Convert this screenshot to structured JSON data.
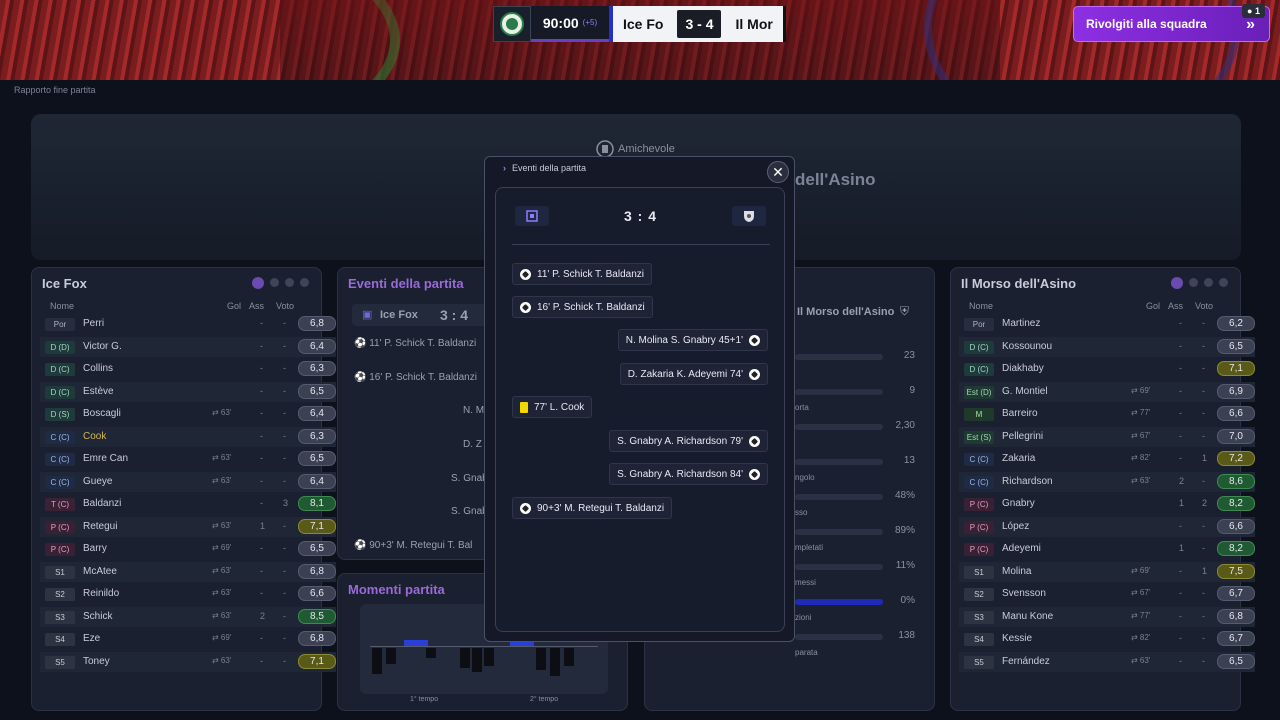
{
  "breadcrumb": "Rapporto fine partita",
  "scoreboard": {
    "time": "90:00",
    "added": "(+5)",
    "home": "Ice Fo",
    "score": "3 - 4",
    "away": "Il Mor"
  },
  "team_button": {
    "label": "Rivolgiti alla squadra",
    "notif": "1"
  },
  "hero": {
    "competition": "Amichevole",
    "away_name_partial": "dell'Asino"
  },
  "home_panel": {
    "title": "Ice Fox",
    "headers": {
      "name": "Nome",
      "goals": "Gol",
      "assists": "Ass",
      "rating": "Voto"
    },
    "players": [
      {
        "pos": "Por",
        "name": "Perri",
        "sub": "",
        "gol": "-",
        "ass": "-",
        "voto": "6,8",
        "cls": "",
        "vcls": ""
      },
      {
        "pos": "D (D)",
        "name": "Victor G.",
        "sub": "",
        "gol": "-",
        "ass": "-",
        "voto": "6,4",
        "cls": "d",
        "vcls": ""
      },
      {
        "pos": "D (C)",
        "name": "Collins",
        "sub": "",
        "gol": "-",
        "ass": "-",
        "voto": "6,3",
        "cls": "d",
        "vcls": ""
      },
      {
        "pos": "D (C)",
        "name": "Estève",
        "sub": "",
        "gol": "-",
        "ass": "-",
        "voto": "6,5",
        "cls": "d",
        "vcls": ""
      },
      {
        "pos": "D (S)",
        "name": "Boscagli",
        "sub": "63'",
        "gol": "-",
        "ass": "-",
        "voto": "6,4",
        "cls": "d",
        "vcls": ""
      },
      {
        "pos": "C (C)",
        "name": "Cook",
        "sub": "",
        "gol": "-",
        "ass": "-",
        "voto": "6,3",
        "cls": "c",
        "vcls": "",
        "yel": true
      },
      {
        "pos": "C (C)",
        "name": "Emre Can",
        "sub": "63'",
        "gol": "-",
        "ass": "-",
        "voto": "6,5",
        "cls": "c",
        "vcls": ""
      },
      {
        "pos": "C (C)",
        "name": "Gueye",
        "sub": "63'",
        "gol": "-",
        "ass": "-",
        "voto": "6,4",
        "cls": "c",
        "vcls": ""
      },
      {
        "pos": "T (C)",
        "name": "Baldanzi",
        "sub": "",
        "gol": "-",
        "ass": "3",
        "voto": "8,1",
        "cls": "t",
        "vcls": "g"
      },
      {
        "pos": "P (C)",
        "name": "Retegui",
        "sub": "63'",
        "gol": "1",
        "ass": "-",
        "voto": "7,1",
        "cls": "p",
        "vcls": "y"
      },
      {
        "pos": "P (C)",
        "name": "Barry",
        "sub": "69'",
        "gol": "-",
        "ass": "-",
        "voto": "6,5",
        "cls": "p",
        "vcls": ""
      },
      {
        "pos": "S1",
        "name": "McAtee",
        "sub": "63'",
        "gol": "-",
        "ass": "-",
        "voto": "6,8",
        "cls": "s",
        "vcls": ""
      },
      {
        "pos": "S2",
        "name": "Reinildo",
        "sub": "63'",
        "gol": "-",
        "ass": "-",
        "voto": "6,6",
        "cls": "s",
        "vcls": ""
      },
      {
        "pos": "S3",
        "name": "Schick",
        "sub": "63'",
        "gol": "2",
        "ass": "-",
        "voto": "8,5",
        "cls": "s",
        "vcls": "g"
      },
      {
        "pos": "S4",
        "name": "Eze",
        "sub": "69'",
        "gol": "-",
        "ass": "-",
        "voto": "6,8",
        "cls": "s",
        "vcls": ""
      },
      {
        "pos": "S5",
        "name": "Toney",
        "sub": "63'",
        "gol": "-",
        "ass": "-",
        "voto": "7,1",
        "cls": "s",
        "vcls": "y"
      }
    ]
  },
  "away_panel": {
    "title": "Il Morso dell'Asino",
    "headers": {
      "name": "Nome",
      "goals": "Gol",
      "assists": "Ass",
      "rating": "Voto"
    },
    "players": [
      {
        "pos": "Por",
        "name": "Martinez",
        "sub": "",
        "gol": "-",
        "ass": "-",
        "voto": "6,2",
        "cls": "",
        "vcls": ""
      },
      {
        "pos": "D (C)",
        "name": "Kossounou",
        "sub": "",
        "gol": "-",
        "ass": "-",
        "voto": "6,5",
        "cls": "d",
        "vcls": ""
      },
      {
        "pos": "D (C)",
        "name": "Diakhaby",
        "sub": "",
        "gol": "-",
        "ass": "-",
        "voto": "7,1",
        "cls": "d",
        "vcls": "y"
      },
      {
        "pos": "Est (D)",
        "name": "G. Montiel",
        "sub": "69'",
        "gol": "-",
        "ass": "-",
        "voto": "6,9",
        "cls": "e",
        "vcls": ""
      },
      {
        "pos": "M",
        "name": "Barreiro",
        "sub": "77'",
        "gol": "-",
        "ass": "-",
        "voto": "6,6",
        "cls": "m",
        "vcls": ""
      },
      {
        "pos": "Est (S)",
        "name": "Pellegrini",
        "sub": "67'",
        "gol": "-",
        "ass": "-",
        "voto": "7,0",
        "cls": "e",
        "vcls": ""
      },
      {
        "pos": "C (C)",
        "name": "Zakaria",
        "sub": "82'",
        "gol": "-",
        "ass": "1",
        "voto": "7,2",
        "cls": "c",
        "vcls": "y"
      },
      {
        "pos": "C (C)",
        "name": "Richardson",
        "sub": "63'",
        "gol": "2",
        "ass": "-",
        "voto": "8,6",
        "cls": "c",
        "vcls": "g"
      },
      {
        "pos": "P (C)",
        "name": "Gnabry",
        "sub": "",
        "gol": "1",
        "ass": "2",
        "voto": "8,2",
        "cls": "p",
        "vcls": "g"
      },
      {
        "pos": "P (C)",
        "name": "López",
        "sub": "",
        "gol": "-",
        "ass": "-",
        "voto": "6,6",
        "cls": "p",
        "vcls": ""
      },
      {
        "pos": "P (C)",
        "name": "Adeyemi",
        "sub": "",
        "gol": "1",
        "ass": "-",
        "voto": "8,2",
        "cls": "p",
        "vcls": "g"
      },
      {
        "pos": "S1",
        "name": "Molina",
        "sub": "69'",
        "gol": "-",
        "ass": "1",
        "voto": "7,5",
        "cls": "s",
        "vcls": "y"
      },
      {
        "pos": "S2",
        "name": "Svensson",
        "sub": "67'",
        "gol": "-",
        "ass": "-",
        "voto": "6,7",
        "cls": "s",
        "vcls": ""
      },
      {
        "pos": "S3",
        "name": "Manu Kone",
        "sub": "77'",
        "gol": "-",
        "ass": "-",
        "voto": "6,8",
        "cls": "s",
        "vcls": ""
      },
      {
        "pos": "S4",
        "name": "Kessie",
        "sub": "82'",
        "gol": "-",
        "ass": "-",
        "voto": "6,7",
        "cls": "s",
        "vcls": ""
      },
      {
        "pos": "S5",
        "name": "Fernández",
        "sub": "63'",
        "gol": "-",
        "ass": "-",
        "voto": "6,5",
        "cls": "s",
        "vcls": ""
      }
    ]
  },
  "mid_panel": {
    "title": "Eventi della partita",
    "home": "Ice Fox",
    "score": "3 : 4",
    "rows": [
      "11' P. Schick T. Baldanzi",
      "16' P. Schick T. Baldanzi",
      "N. M",
      "D. Z",
      "S. Gnab",
      "S. Gnab",
      "90+3' M. Retegui T. Bal"
    ]
  },
  "moments": {
    "title": "Momenti partita",
    "first_half": "1° tempo",
    "second_half": "2° tempo"
  },
  "stats_panel": {
    "away": "Il Morso dell'Asino",
    "values": [
      "23",
      "9",
      "2,30",
      "13",
      "48%",
      "89%",
      "11%",
      "0%",
      "138"
    ],
    "labels": [
      "",
      "orta",
      "",
      "ngolo",
      "sso",
      "mpletati",
      "messi",
      "zioni",
      "parata"
    ]
  },
  "modal": {
    "title": "Eventi della partita",
    "score": "3 : 4",
    "events": [
      {
        "text": "11' P. Schick  T. Baldanzi",
        "side": "home",
        "icon": "ball"
      },
      {
        "text": "16' P. Schick  T. Baldanzi",
        "side": "home",
        "icon": "ball"
      },
      {
        "text": "N. Molina  S. Gnabry  45+1'",
        "side": "away",
        "icon": "ball"
      },
      {
        "text": "D. Zakaria  K. Adeyemi  74'",
        "side": "away",
        "icon": "ball"
      },
      {
        "text": "77'  L. Cook",
        "side": "home",
        "icon": "card"
      },
      {
        "text": "S. Gnabry  A. Richardson  79'",
        "side": "away",
        "icon": "ball"
      },
      {
        "text": "S. Gnabry  A. Richardson  84'",
        "side": "away",
        "icon": "ball"
      },
      {
        "text": "90+3'  M. Retegui  T. Baldanzi",
        "side": "home",
        "icon": "ball"
      }
    ]
  }
}
